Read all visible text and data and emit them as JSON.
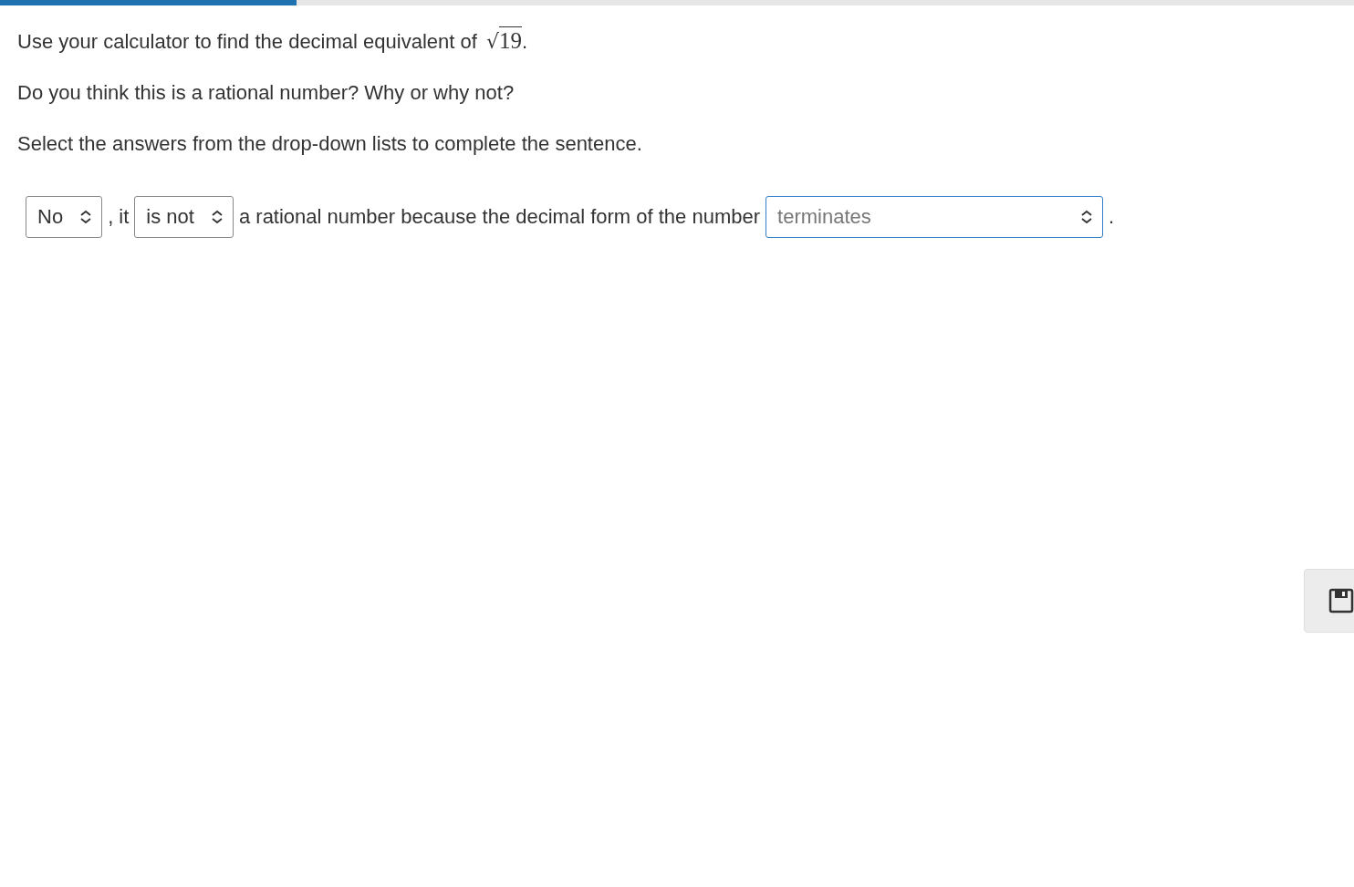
{
  "progress": {
    "level": 0.219
  },
  "question": {
    "prompt": "Use your calculator to find the decimal equivalent of ",
    "radical": "√",
    "radicand": "19",
    "end": "."
  },
  "paragraphs": [
    "Do you think this is a rational number? Why or why not?",
    "Select the answers from the drop-down lists to complete the sentence."
  ],
  "sentence": [
    {
      "kind": "select",
      "value": "No",
      "focused": false
    },
    {
      "kind": "text",
      "text": ", it"
    },
    {
      "kind": "select",
      "value": "is not",
      "focused": false
    },
    {
      "kind": "text",
      "text": "a rational number because the decimal form of the number"
    },
    {
      "kind": "select",
      "value": "terminates",
      "focused": true,
      "wide": true
    },
    {
      "kind": "text",
      "text": "."
    }
  ],
  "save_button": {
    "kind": "save"
  }
}
